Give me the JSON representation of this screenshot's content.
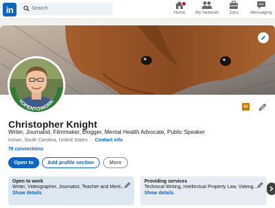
{
  "nav": {
    "logo": "in",
    "search_placeholder": "Search",
    "items": [
      {
        "label": "Home"
      },
      {
        "label": "My Network"
      },
      {
        "label": "Jobs"
      },
      {
        "label": "Messaging"
      }
    ]
  },
  "profile": {
    "name": "Christopher Knight",
    "headline": "Writer, Journalist, Filmmaker, Blogger, Mental Health Advocate, Public Speaker",
    "location": "Inman, South Carolina, United States",
    "location_separator": "·",
    "contact_info": "Contact info",
    "connections": "76 connections",
    "frame_text": "#OPENTOWORK",
    "company_logo": "in"
  },
  "actions": {
    "open_to": "Open to",
    "add_section": "Add profile section",
    "more": "More"
  },
  "panels": [
    {
      "title": "Open to work",
      "description": "Writer, Videographer, Journalist, Teacher and Ment...",
      "link": "Show details"
    },
    {
      "title": "Providing services",
      "description": "Technical Writing, Intellectual Property Law, Videog...",
      "link": "Show details"
    }
  ],
  "colors": {
    "brand": "#0a66c2",
    "open_to_work_frame": "#2e7d32",
    "notification_badge": "#cb112d"
  },
  "icons": [
    "search-icon",
    "home-icon",
    "network-icon",
    "jobs-icon",
    "messaging-icon",
    "pencil-icon",
    "chevron-right-icon"
  ]
}
